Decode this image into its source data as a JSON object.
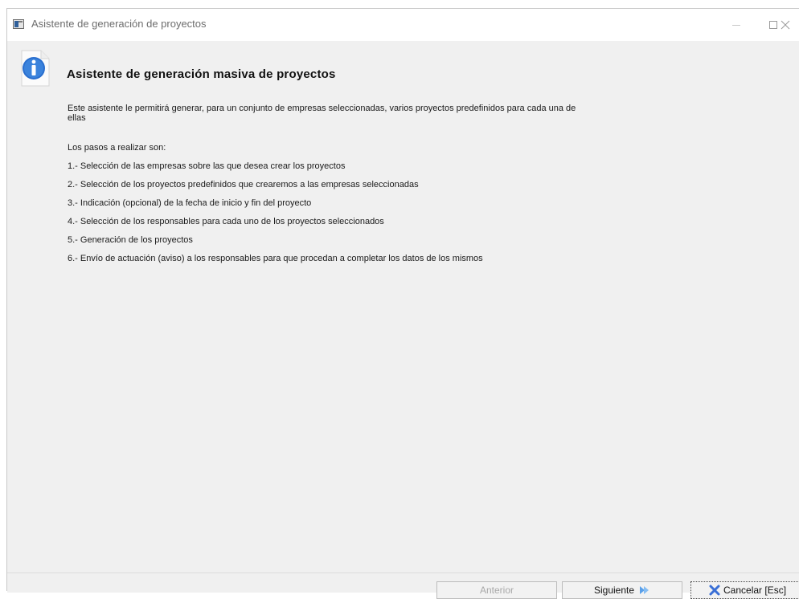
{
  "window": {
    "title": "Asistente de generación de proyectos",
    "icon": "app-window-icon",
    "controls": [
      "minimize-icon",
      "maximize-icon",
      "close-icon"
    ]
  },
  "header": {
    "icon": "info-icon",
    "title": "Asistente de generación masiva de proyectos"
  },
  "description": "Este asistente le permitirá generar, para un conjunto de empresas seleccionadas, varios proyectos predefinidos para cada una de ellas",
  "steps_intro": "Los pasos a realizar son:",
  "steps": [
    "1.- Selección de las empresas sobre las que desea crear los proyectos",
    "2.- Selección de los proyectos predefinidos que crearemos a las empresas seleccionadas",
    "3.- Indicación (opcional) de la fecha de inicio y fin del proyecto",
    "4.- Selección de los responsables para cada uno de los proyectos seleccionados",
    "5.- Generación de los proyectos",
    "6.- Envío de actuación (aviso) a los responsables para que procedan a completar los datos de los mismos"
  ],
  "buttons": {
    "previous": "Anterior",
    "next": "Siguiente",
    "cancel": "Cancelar [Esc]"
  },
  "colors": {
    "accent_blue": "#2a6fcf",
    "cancel_icon": "#3a6fd6",
    "window_bg": "#f0f0f0"
  }
}
